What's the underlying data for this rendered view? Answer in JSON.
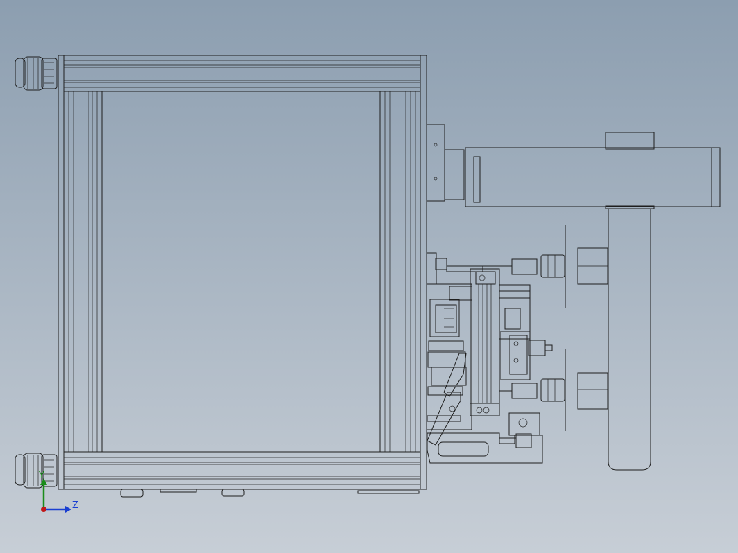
{
  "view": {
    "background_top": "#8c9eb0",
    "background_bottom": "#c7ced6",
    "part_fill": "#6b6b6b",
    "part_fill_dark": "#5a5a5a",
    "edge_color": "#1e1e1e"
  },
  "triad": {
    "x_label": "",
    "y_label": "Y",
    "z_label": "Z",
    "y_color": "#1a8c1a",
    "z_color": "#1a3fd1",
    "origin_color": "#c01818"
  }
}
